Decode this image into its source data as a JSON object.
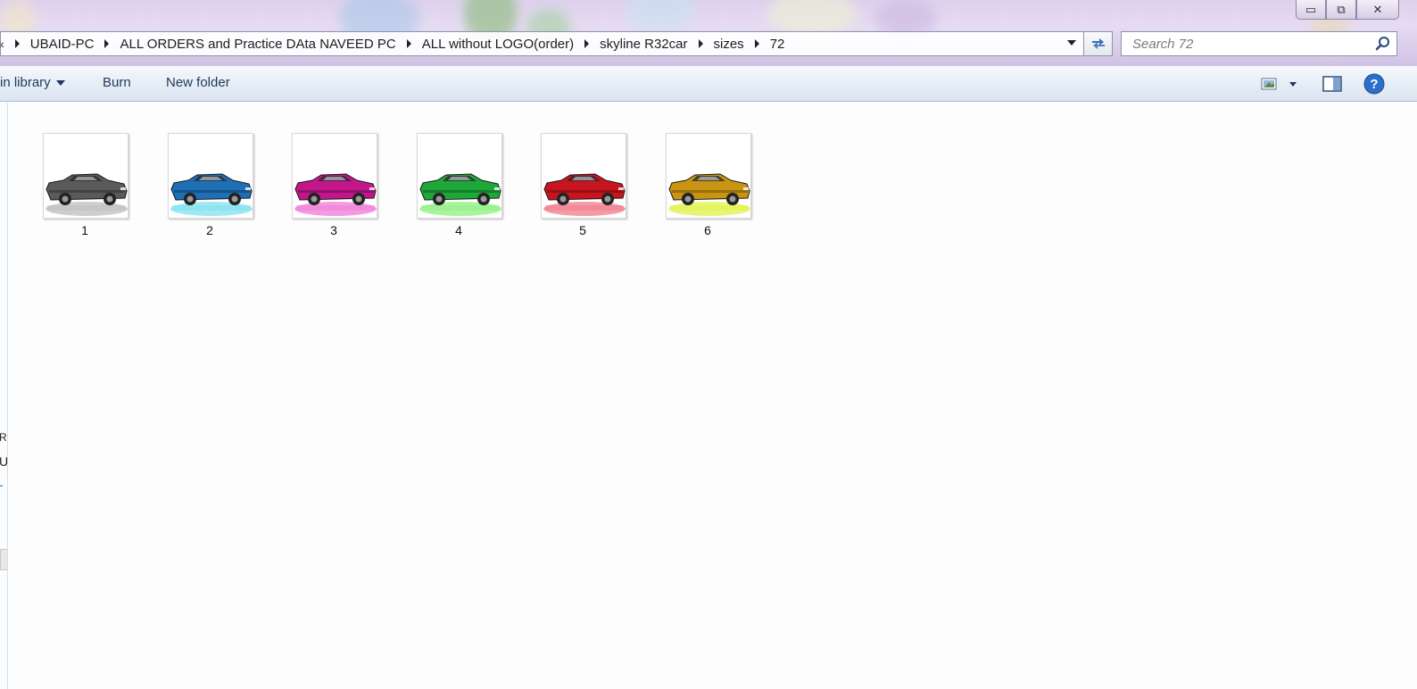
{
  "window": {
    "controls": {
      "minimize": "▭",
      "maximize": "⧉",
      "close": "✕"
    }
  },
  "address": {
    "leading": "«",
    "crumbs": [
      "UBAID-PC",
      "ALL ORDERS and Practice DAta NAVEED PC",
      "ALL without LOGO(order)",
      "skyline R32car",
      "sizes",
      "72"
    ]
  },
  "search": {
    "placeholder": "Search 72"
  },
  "toolbar": {
    "include_library": "in library",
    "burn": "Burn",
    "new_folder": "New folder"
  },
  "navpane": {
    "fragments": [
      "R",
      "U",
      "-"
    ]
  },
  "files": [
    {
      "name": "1",
      "color": "#5a5a5a",
      "glow": "#bdbdbd"
    },
    {
      "name": "2",
      "color": "#1f6fb6",
      "glow": "#7fe0f0"
    },
    {
      "name": "3",
      "color": "#c3168b",
      "glow": "#f07ad8"
    },
    {
      "name": "4",
      "color": "#1fa83a",
      "glow": "#8ef080"
    },
    {
      "name": "5",
      "color": "#c8141e",
      "glow": "#f07a8a"
    },
    {
      "name": "6",
      "color": "#c99412",
      "glow": "#e2f24a"
    }
  ],
  "colors": {
    "cmd_text": "#1e395b",
    "help_blue": "#2d6ec7"
  }
}
